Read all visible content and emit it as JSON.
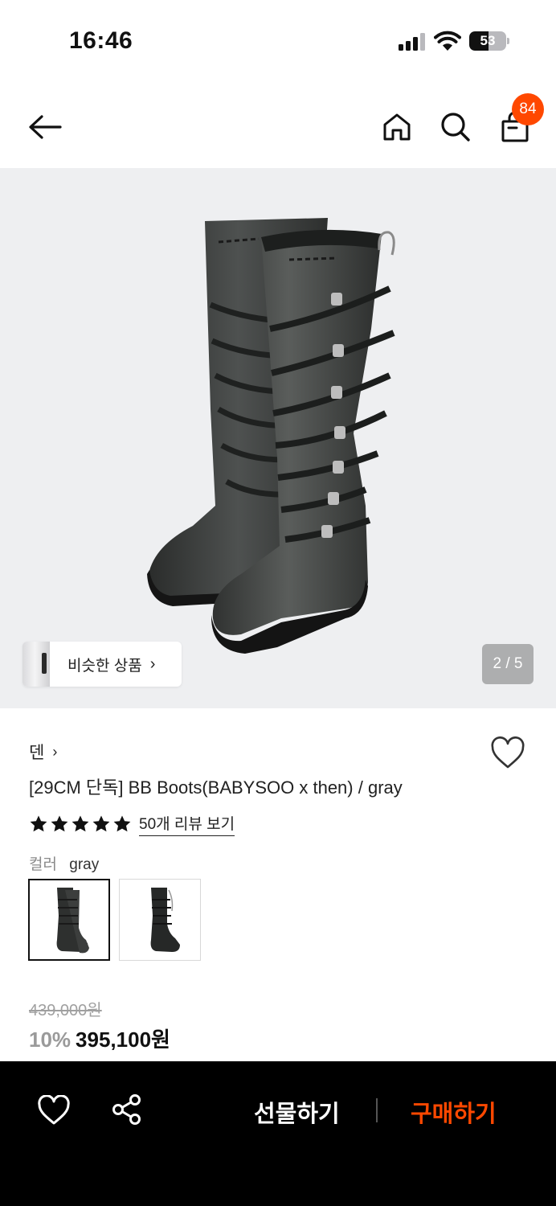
{
  "status_bar": {
    "time": "16:46",
    "battery": "53",
    "battery_level_percent": 53
  },
  "nav": {
    "cart_count": "84",
    "icons": [
      "back-arrow-icon",
      "home-icon",
      "search-icon",
      "shopping-bag-icon"
    ]
  },
  "hero": {
    "similar_label": "비슷한 상품",
    "similar_chevron": "›",
    "page_indicator": "2 / 5"
  },
  "product": {
    "brand": "덴",
    "brand_chevron": "›",
    "title": "[29CM 단독] BB Boots(BABYSOO x then) / gray",
    "rating_stars": 5,
    "review_link": "50개 리뷰 보기",
    "color_label": "컬러",
    "color_value": "gray",
    "original_price": "439,000원",
    "discount": "10%",
    "sale_price": "395,100원"
  },
  "bottom_bar": {
    "gift_label": "선물하기",
    "buy_label": "구매하기"
  },
  "colors": {
    "accent": "#ff4800",
    "bottom_bar_bg": "#000000",
    "hero_bg": "#eeeff1"
  }
}
